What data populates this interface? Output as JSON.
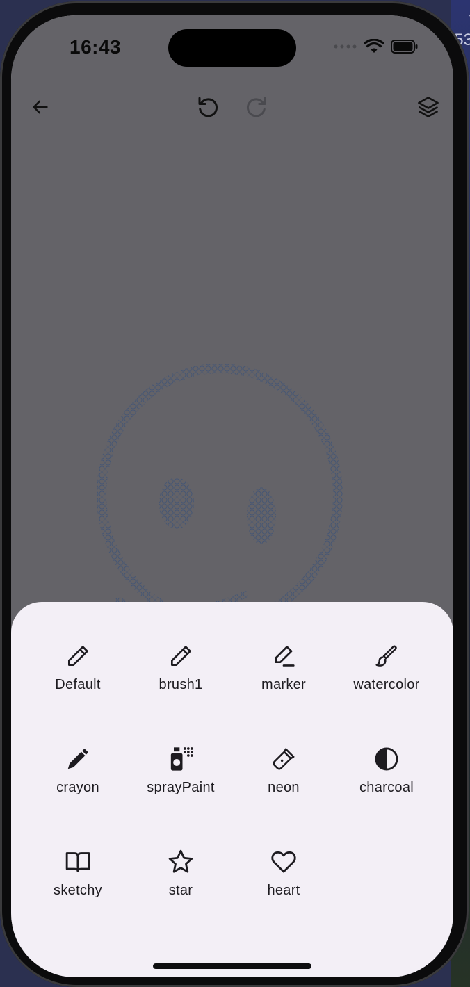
{
  "status_bar": {
    "time": "16:43"
  },
  "toolbar": {
    "back_icon": "arrow-left-icon",
    "undo_icon": "undo-icon",
    "redo_icon": "redo-icon",
    "layers_icon": "layers-icon"
  },
  "brush_sheet": {
    "brushes": [
      {
        "label": "Default",
        "icon": "pencil-outline-icon"
      },
      {
        "label": "brush1",
        "icon": "pencil-outline-icon"
      },
      {
        "label": "marker",
        "icon": "marker-icon"
      },
      {
        "label": "watercolor",
        "icon": "paint-brush-icon"
      },
      {
        "label": "crayon",
        "icon": "crayon-icon"
      },
      {
        "label": "sprayPaint",
        "icon": "spray-can-icon"
      },
      {
        "label": "neon",
        "icon": "flashlight-icon"
      },
      {
        "label": "charcoal",
        "icon": "half-circle-icon"
      },
      {
        "label": "sketchy",
        "icon": "open-book-icon"
      },
      {
        "label": "star",
        "icon": "star-icon"
      },
      {
        "label": "heart",
        "icon": "heart-icon"
      }
    ]
  },
  "colors": {
    "sheet_background": "#f3eff6",
    "stroke_color": "#5a86c8"
  }
}
